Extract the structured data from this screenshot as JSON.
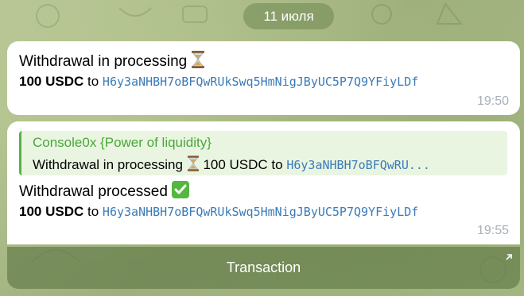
{
  "date_label": "11 июля",
  "messages": [
    {
      "title": "Withdrawal in processing",
      "title_icon": "hourglass-icon",
      "amount": "100 USDC",
      "to_word": "to",
      "address": "H6y3aNHBH7oBFQwRUkSwq5HmNigJByUC5P7Q9YFiyLDf",
      "time": "19:50"
    },
    {
      "reply": {
        "sender": "Console0x {Power of liquidity}",
        "text_before": "Withdrawal in processing",
        "icon": "hourglass-icon",
        "text_after": "100 USDC to",
        "address": "H6y3aNHBH7oBFQwRU..."
      },
      "title": "Withdrawal processed",
      "title_icon": "check-mark-icon",
      "amount": "100 USDC",
      "to_word": "to",
      "address": "H6y3aNHBH7oBFQwRUkSwq5HmNigJByUC5P7Q9YFiyLDf",
      "time": "19:55"
    }
  ],
  "inline_button": {
    "label": "Transaction",
    "icon": "arrow-up-right-icon"
  },
  "colors": {
    "accent_green": "#4aa73a",
    "link_blue": "#3a7bb8",
    "check_green": "#55b740"
  }
}
